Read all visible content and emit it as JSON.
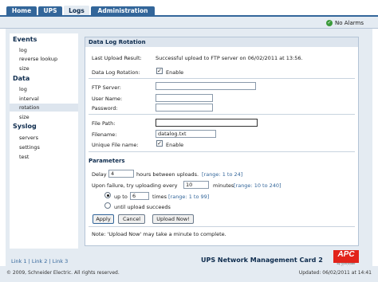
{
  "tabs": [
    {
      "label": "Home",
      "active": false
    },
    {
      "label": "UPS",
      "active": false
    },
    {
      "label": "Logs",
      "active": true
    },
    {
      "label": "Administration",
      "active": false
    }
  ],
  "status": {
    "alarm_text": "No Alarms",
    "alarm_color": "#3a9a3a"
  },
  "sidebar": {
    "events": {
      "title": "Events",
      "items": [
        "log",
        "reverse lookup",
        "size"
      ]
    },
    "data": {
      "title": "Data",
      "items": [
        "log",
        "interval",
        "rotation",
        "size"
      ],
      "selected": "rotation"
    },
    "syslog": {
      "title": "Syslog",
      "items": [
        "servers",
        "settings",
        "test"
      ]
    }
  },
  "panel": {
    "title": "Data Log Rotation",
    "last_upload_label": "Last Upload Result:",
    "last_upload_value": "Successful upload to FTP server on 06/02/2011 at 13:56.",
    "rotation_label": "Data Log Rotation:",
    "rotation_checked": true,
    "rotation_enable": "Enable",
    "ftp_server_label": "FTP Server:",
    "ftp_server_value": "",
    "username_label": "User Name:",
    "username_value": "",
    "password_label": "Password:",
    "password_value": "",
    "filepath_label": "File Path:",
    "filepath_value": "",
    "filename_label": "Filename:",
    "filename_value": "datalog.txt",
    "unique_label": "Unique File name:",
    "unique_checked": true,
    "unique_enable": "Enable",
    "parameters_title": "Parameters",
    "delay_prefix": "Delay",
    "delay_value": "4",
    "delay_suffix": "hours between uploads.",
    "delay_range": "[range: 1 to 24]",
    "failure_prefix": "Upon failure, try uploading every",
    "failure_value": "10",
    "failure_suffix": "minutes",
    "failure_range": "[range: 10 to 240]",
    "upto_prefix": "up to",
    "upto_value": "6",
    "upto_suffix": "times",
    "upto_range": "[range: 1 to 99]",
    "until_label": "until upload succeeds",
    "apply_label": "Apply",
    "cancel_label": "Cancel",
    "upload_label": "Upload Now!",
    "note": "Note: 'Upload Now' may take a minute to complete."
  },
  "footer": {
    "links": [
      "Link 1",
      "Link 2",
      "Link 3"
    ],
    "product": "UPS Network Management Card 2",
    "logo": "APC",
    "logo_sub": "by Schneider Electric",
    "copyright": "© 2009, Schneider Electric. All rights reserved.",
    "updated": "Updated: 06/02/2011 at 14:41"
  },
  "colors": {
    "brand": "#33669a",
    "accent": "#e2231a",
    "panel_bg": "#e4ebf2"
  }
}
